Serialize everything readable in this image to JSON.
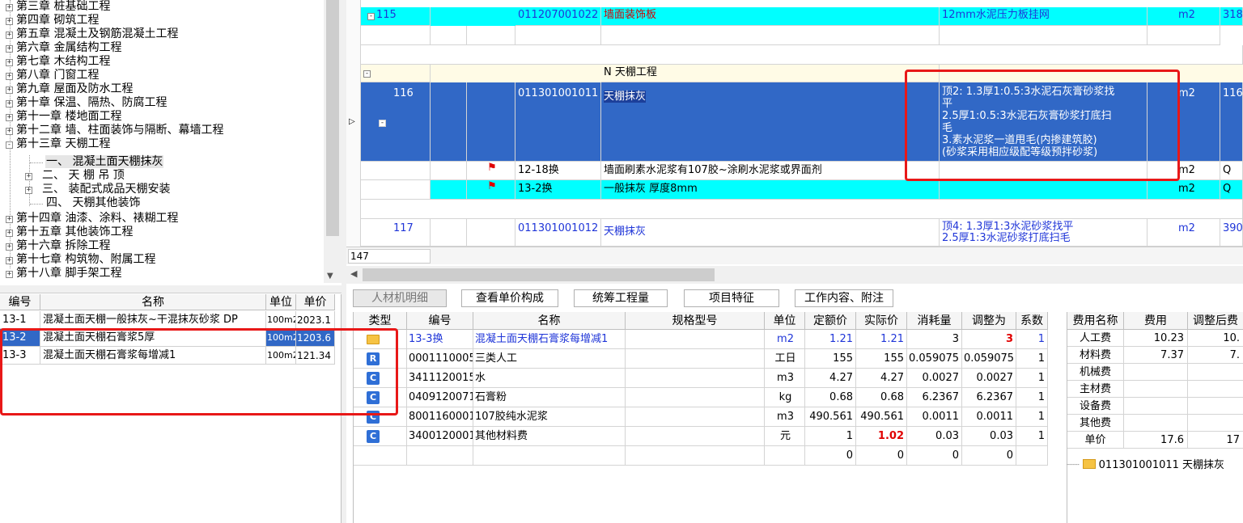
{
  "tree": {
    "nodes": [
      {
        "label": "第三章 桩基础工程",
        "sign": "+"
      },
      {
        "label": "第四章 砌筑工程",
        "sign": "+"
      },
      {
        "label": "第五章 混凝土及钢筋混凝土工程",
        "sign": "+"
      },
      {
        "label": "第六章 金属结构工程",
        "sign": "+"
      },
      {
        "label": "第七章 木结构工程",
        "sign": "+"
      },
      {
        "label": "第八章 门窗工程",
        "sign": "+"
      },
      {
        "label": "第九章 屋面及防水工程",
        "sign": "+"
      },
      {
        "label": "第十章 保温、隔热、防腐工程",
        "sign": "+"
      },
      {
        "label": "第十一章 楼地面工程",
        "sign": "+"
      },
      {
        "label": "第十二章 墙、柱面装饰与隔断、幕墙工程",
        "sign": "+"
      },
      {
        "label": "第十三章 天棚工程",
        "sign": "-"
      },
      {
        "label": "一、  混凝土面天棚抹灰",
        "sign": ""
      },
      {
        "label": "二、  天 棚 吊 顶",
        "sign": "+"
      },
      {
        "label": "三、  装配式成品天棚安装",
        "sign": "+"
      },
      {
        "label": "四、  天棚其他装饰",
        "sign": ""
      },
      {
        "label": "第十四章 油漆、涂料、裱糊工程",
        "sign": "+"
      },
      {
        "label": "第十五章 其他装饰工程",
        "sign": "+"
      },
      {
        "label": "第十六章 拆除工程",
        "sign": "+"
      },
      {
        "label": "第十七章 构筑物、附属工程",
        "sign": "+"
      },
      {
        "label": "第十八章 脚手架工程",
        "sign": "+"
      }
    ]
  },
  "quota": {
    "headers": [
      "编号",
      "名称",
      "单位",
      "单价"
    ],
    "rows": [
      {
        "code": "13-1",
        "name": "混凝土面天棚一般抹灰~干混抹灰砂浆 DP",
        "unit": "100m2",
        "price": "2023.1"
      },
      {
        "code": "13-2",
        "name": "混凝土面天棚石膏浆5厚",
        "unit": "100m2",
        "price": "1203.6"
      },
      {
        "code": "13-3",
        "name": "混凝土面天棚石膏浆每增减1",
        "unit": "100m2",
        "price": "121.34"
      }
    ]
  },
  "grid": {
    "row115": {
      "num": "115",
      "code": "011207001022",
      "name": "墙面装饰板",
      "spec": "12mm水泥压力板挂网",
      "unit": "m2",
      "qty": "318."
    },
    "section": {
      "name": "N 天棚工程"
    },
    "row116": {
      "num": "116",
      "code": "011301001011",
      "name": "天棚抹灰",
      "spec_lines": [
        "顶2: 1.3厚1:0.5:3水泥石灰膏砂浆找",
        "平",
        "2.5厚1:0.5:3水泥石灰膏砂浆打底扫",
        "毛",
        "3.素水泥浆一道甩毛(内掺建筑胶)",
        "(砂浆采用相应级配等级预拌砂浆)"
      ],
      "unit": "m2",
      "qty": "1162"
    },
    "sub1": {
      "code": "12-18换",
      "name": "墙面刷素水泥浆有107胶~涂刷水泥浆或界面剂",
      "unit": "m2",
      "qty": "Q"
    },
    "sub2": {
      "code": "13-2换",
      "name": "一般抹灰 厚度8mm",
      "unit": "m2",
      "qty": "Q"
    },
    "row117": {
      "num": "117",
      "code": "011301001012",
      "name": "天棚抹灰",
      "spec_lines": [
        "顶4: 1.3厚1:3水泥砂浆找平",
        "2.5厚1:3水泥砂浆打底扫毛"
      ],
      "unit": "m2",
      "qty": "390."
    },
    "count": "147"
  },
  "tabs": [
    "人材机明细",
    "查看单价构成",
    "统筹工程量",
    "项目特征",
    "工作内容、附注"
  ],
  "detail": {
    "headers": [
      "类型",
      "编号",
      "名称",
      "规格型号",
      "单位",
      "定额价",
      "实际价",
      "消耗量",
      "调整为",
      "系数"
    ],
    "rows": [
      {
        "type": "folder",
        "code": "13-3换",
        "name": "混凝土面天棚石膏浆每增减1",
        "spec": "",
        "unit": "m2",
        "base": "1.21",
        "actual": "1.21",
        "consume": "3",
        "adjust": "3",
        "coef": "1"
      },
      {
        "type": "R",
        "code": "0001110005",
        "name": "三类人工",
        "spec": "",
        "unit": "工日",
        "base": "155",
        "actual": "155",
        "consume": "0.059075",
        "adjust": "0.059075",
        "coef": "1"
      },
      {
        "type": "C",
        "code": "3411120015",
        "name": "水",
        "spec": "",
        "unit": "m3",
        "base": "4.27",
        "actual": "4.27",
        "consume": "0.0027",
        "adjust": "0.0027",
        "coef": "1"
      },
      {
        "type": "C",
        "code": "0409120071",
        "name": "石膏粉",
        "spec": "",
        "unit": "kg",
        "base": "0.68",
        "actual": "0.68",
        "consume": "6.2367",
        "adjust": "6.2367",
        "coef": "1"
      },
      {
        "type": "C",
        "code": "8001160001",
        "name": "107胶纯水泥浆",
        "spec": "",
        "unit": "m3",
        "base": "490.561",
        "actual": "490.561",
        "consume": "0.0011",
        "adjust": "0.0011",
        "coef": "1"
      },
      {
        "type": "C",
        "code": "3400120001",
        "name": "其他材料费",
        "spec": "",
        "unit": "元",
        "base": "1",
        "actual": "1.02",
        "consume": "0.03",
        "adjust": "0.03",
        "coef": "1"
      }
    ],
    "totals": {
      "base": "0",
      "actual": "0",
      "consume": "0",
      "adjust": "0"
    }
  },
  "fees": {
    "headers": [
      "费用名称",
      "费用",
      "调整后费"
    ],
    "rows": [
      {
        "name": "人工费",
        "fee": "10.23",
        "adj": "10."
      },
      {
        "name": "材料费",
        "fee": "7.37",
        "adj": "7."
      },
      {
        "name": "机械费",
        "fee": "",
        "adj": ""
      },
      {
        "name": "主材费",
        "fee": "",
        "adj": ""
      },
      {
        "name": "设备费",
        "fee": "",
        "adj": ""
      },
      {
        "name": "其他费",
        "fee": "",
        "adj": ""
      },
      {
        "name": "单价",
        "fee": "17.6",
        "adj": "17"
      }
    ],
    "tree_label": "011301001011 天棚抹灰"
  },
  "colors": {
    "selection": "#3168c6",
    "highlight_row": "#00ffff",
    "annotation": "#e81818"
  }
}
